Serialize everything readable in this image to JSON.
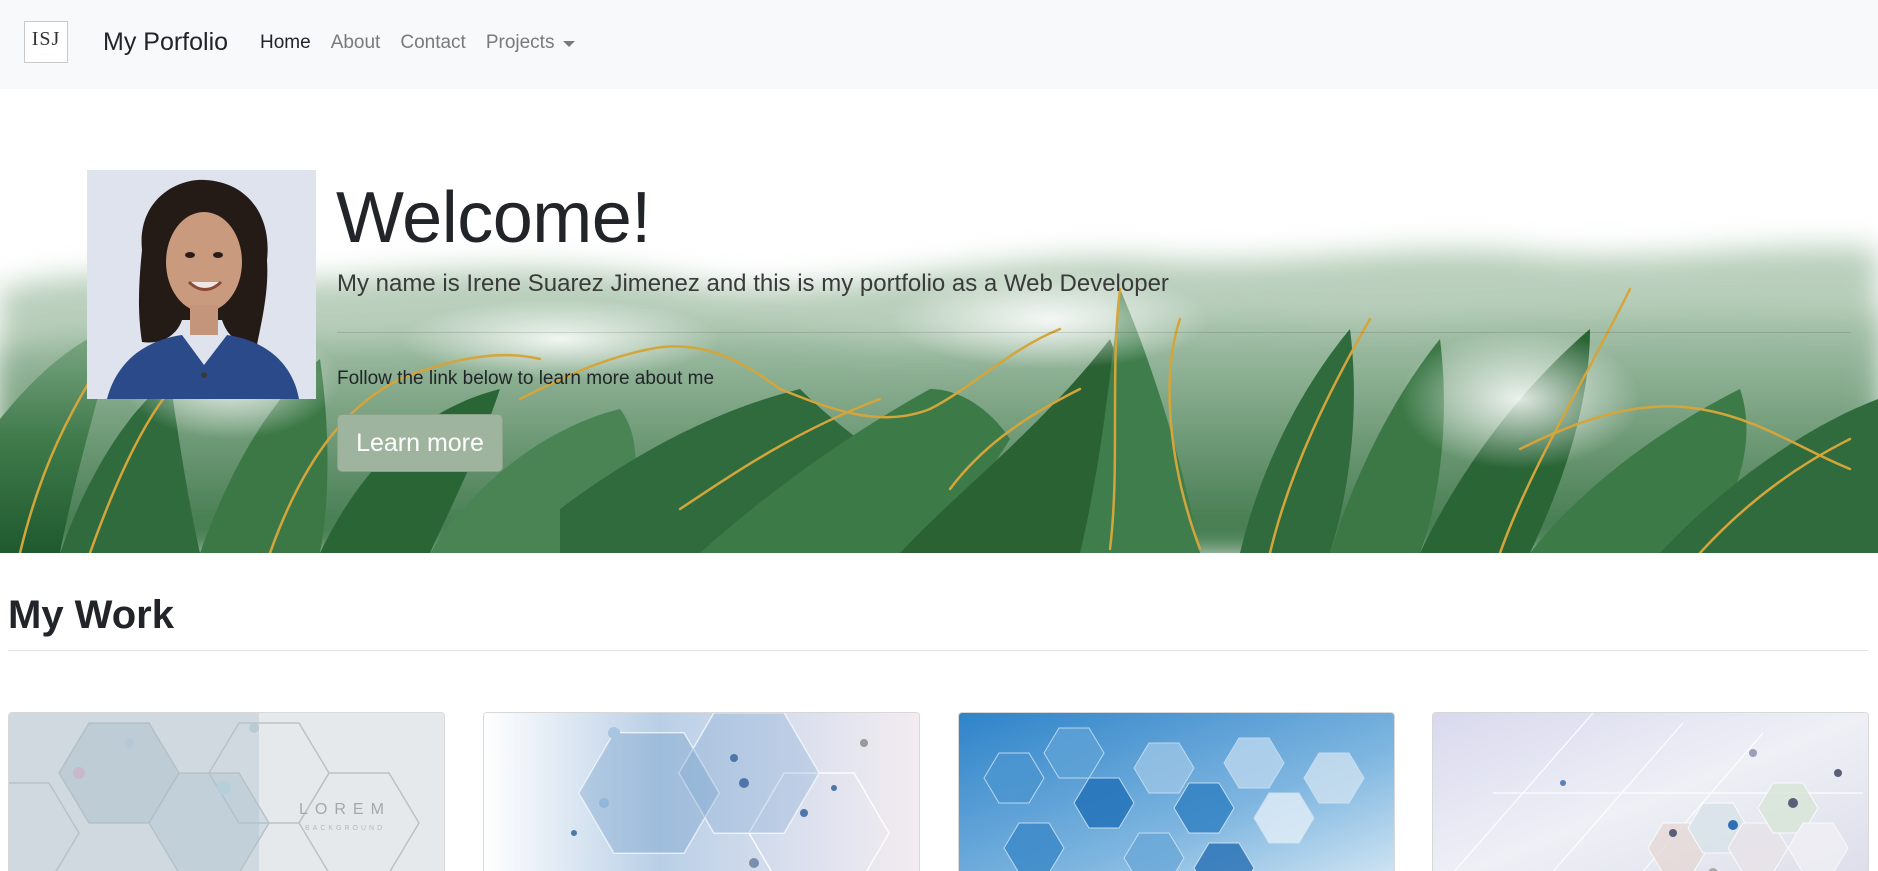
{
  "navbar": {
    "logo_text": "ISJ",
    "brand": "My Porfolio",
    "links": [
      {
        "label": "Home",
        "active": true
      },
      {
        "label": "About",
        "active": false
      },
      {
        "label": "Contact",
        "active": false
      },
      {
        "label": "Projects",
        "active": false,
        "dropdown": true
      }
    ]
  },
  "hero": {
    "title": "Welcome!",
    "lead": "My name is Irene Suarez Jimenez and this is my portfolio as a Web Developer",
    "text": "Follow the link below to learn more about me",
    "button_label": "Learn more"
  },
  "work": {
    "title": "My Work",
    "cards": [
      {
        "image": "hexagon-background-lorem",
        "overlay_title": "LOREM",
        "overlay_sub": "BACKGROUND"
      },
      {
        "image": "hexagon-network-background"
      },
      {
        "image": "blue-hexagon-background"
      },
      {
        "image": "tech-network-background"
      }
    ]
  },
  "colors": {
    "navbar_bg": "#f8f9fa",
    "button_bg": "#9fb49e",
    "text_dark": "#212529",
    "nav_muted": "#7a7a7a",
    "leaf_green": "#2f6b3c",
    "gold": "#d4a53a"
  }
}
